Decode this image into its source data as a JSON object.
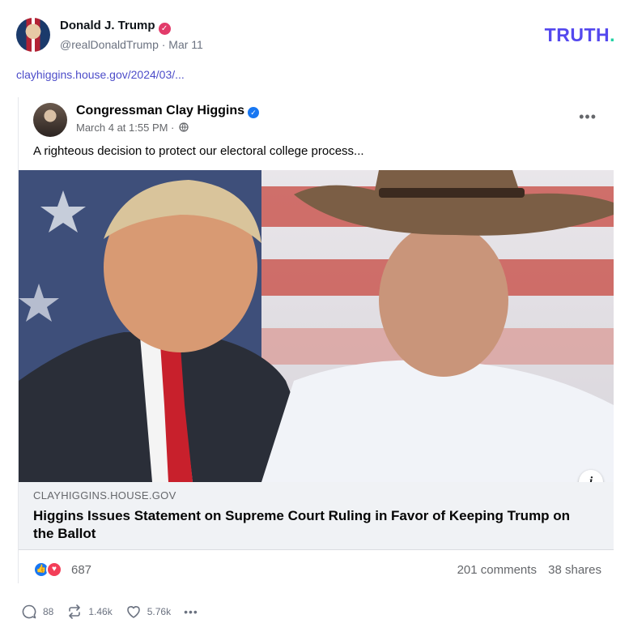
{
  "post": {
    "author_name": "Donald J. Trump",
    "author_handle_date": "@realDonaldTrump · Mar 11",
    "link": "clayhiggins.house.gov/2024/03/..."
  },
  "brand": {
    "logo_text": "TRUTH",
    "logo_dot": ".",
    "accent": "#5448ee",
    "dot_color": "#1fd1a3"
  },
  "embed": {
    "page_name": "Congressman Clay Higgins",
    "timestamp": "March 4 at 1:55 PM ·",
    "more_label": "•••",
    "text": "A righteous decision to protect our electoral college process...",
    "info_label": "i",
    "preview_domain": "CLAYHIGGINS.HOUSE.GOV",
    "preview_title": "Higgins Issues Statement on Supreme Court Ruling in Favor of Keeping Trump on the Ballot",
    "reaction_count": "687",
    "comments": "201 comments",
    "shares": "38 shares"
  },
  "actions": {
    "replies": "88",
    "retruths": "1.46k",
    "likes": "5.76k",
    "more": "•••"
  },
  "icons": [
    "verified-icon",
    "globe-icon",
    "info-icon",
    "like-reaction-icon",
    "love-reaction-icon",
    "reply-icon",
    "retruth-icon",
    "heart-icon",
    "more-icon"
  ]
}
